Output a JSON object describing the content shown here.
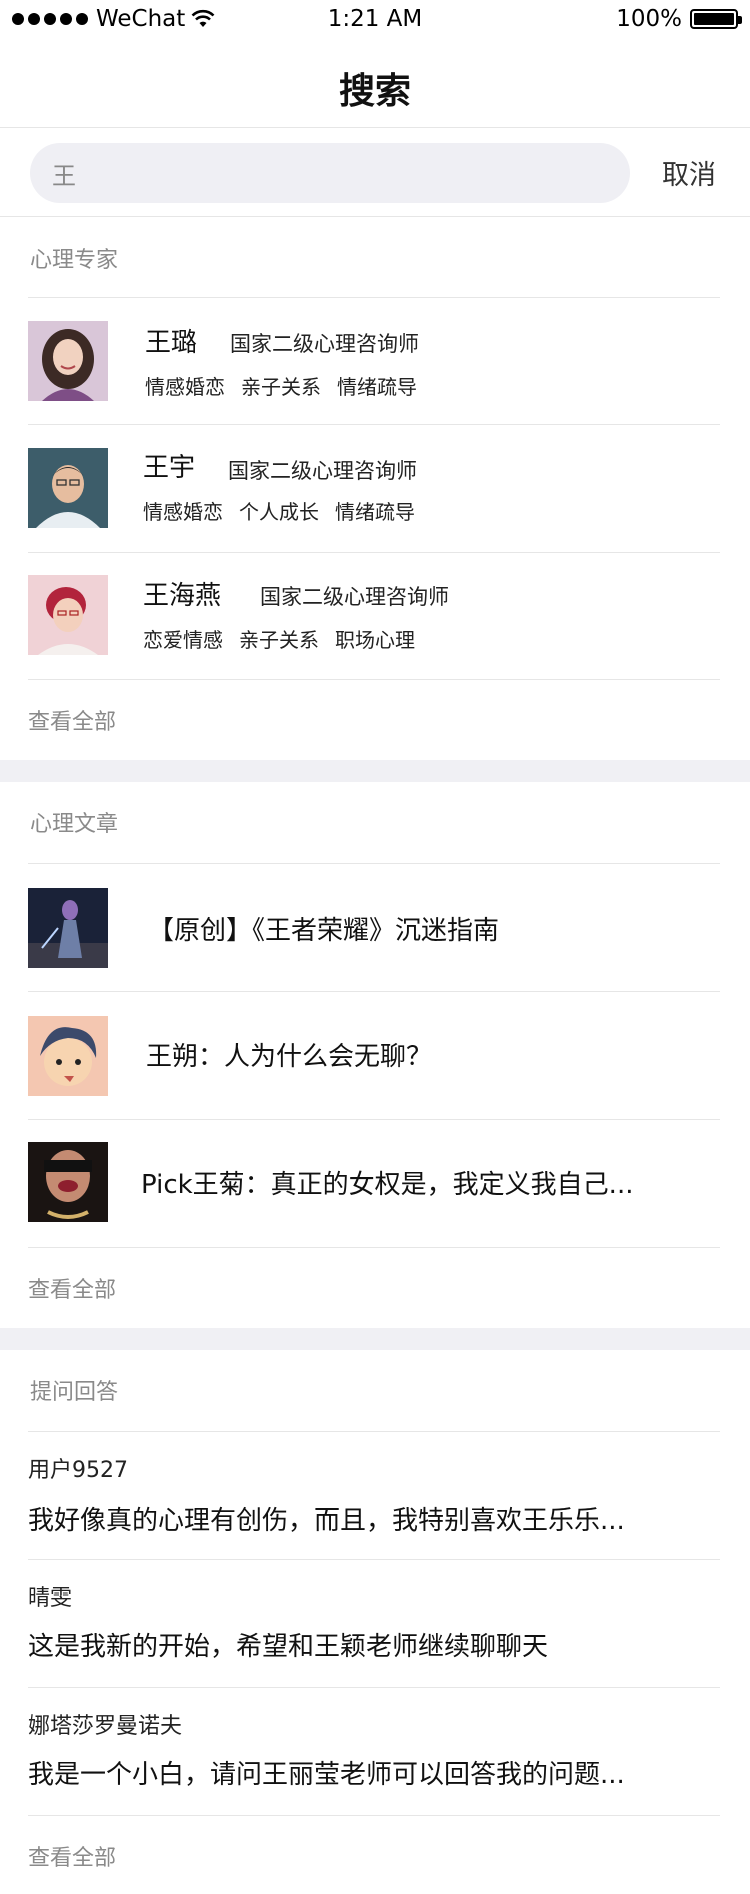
{
  "status": {
    "carrier": "WeChat",
    "time": "1:21 AM",
    "battery": "100%",
    "battery_level": 1.0
  },
  "nav": {
    "title": "搜索"
  },
  "search": {
    "query": "王",
    "cancel_label": "取消"
  },
  "experts": {
    "title": "心理专家",
    "items": [
      {
        "name": "王璐",
        "title": "国家二级心理咨询师",
        "tags": [
          "情感婚恋",
          "亲子关系",
          "情绪疏导"
        ]
      },
      {
        "name": "王宇",
        "title": "国家二级心理咨询师",
        "tags": [
          "情感婚恋",
          "个人成长",
          "情绪疏导"
        ]
      },
      {
        "name": "王海燕",
        "title": "国家二级心理咨询师",
        "tags": [
          "恋爱情感",
          "亲子关系",
          "职场心理"
        ]
      }
    ],
    "see_all": "查看全部"
  },
  "articles": {
    "title": "心理文章",
    "items": [
      {
        "text": "【原创】《王者荣耀》沉迷指南"
      },
      {
        "text": "王朔：人为什么会无聊？"
      },
      {
        "text": "Pick王菊：真正的女权是，我定义我自己..."
      }
    ],
    "see_all": "查看全部"
  },
  "qa": {
    "title": "提问回答",
    "items": [
      {
        "user": "用户9527",
        "text": "我好像真的心理有创伤，而且，我特别喜欢王乐乐..."
      },
      {
        "user": "晴雯",
        "text": "这是我新的开始，希望和王颖老师继续聊聊天"
      },
      {
        "user": "娜塔莎罗曼诺夫",
        "text": "我是一个小白，请问王丽莹老师可以回答我的问题..."
      }
    ],
    "see_all": "查看全部"
  }
}
